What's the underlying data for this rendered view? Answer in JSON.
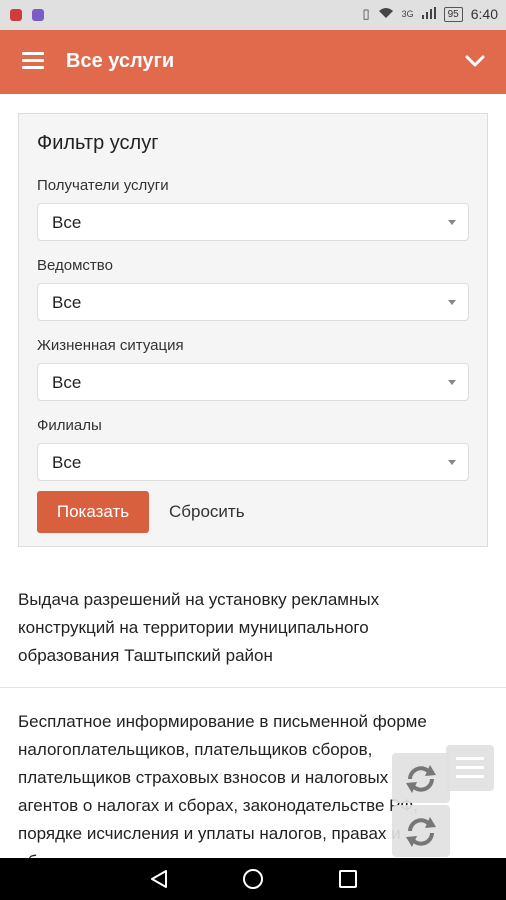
{
  "status_bar": {
    "time": "6:40",
    "network_label": "3G",
    "battery_level": "95"
  },
  "app_bar": {
    "title": "Все услуги"
  },
  "filter": {
    "title": "Фильтр услуг",
    "fields": [
      {
        "label": "Получатели услуги",
        "value": "Все"
      },
      {
        "label": "Ведомство",
        "value": "Все"
      },
      {
        "label": "Жизненная ситуация",
        "value": "Все"
      },
      {
        "label": "Филиалы",
        "value": "Все"
      }
    ],
    "show_label": "Показать",
    "reset_label": "Сбросить"
  },
  "services": [
    {
      "lines": [
        "Выдача разрешений на установку рекламных",
        "конструкций на территории муниципального",
        "образования Таштыпский район"
      ]
    },
    {
      "lines": [
        "Бесплатное информирование в письменной форме",
        "налогоплательщиков, плательщиков сборов,",
        "плательщиков страховых взносов и налоговых",
        "агентов о налогах и сборах, законодательстве РФ,",
        "порядке исчисления и уплаты налогов, правах и",
        "обязанностях"
      ]
    }
  ],
  "colors": {
    "accent": "#e06a4b",
    "button": "#d9603f"
  },
  "icons": [
    "menu-icon",
    "chevron-down-icon",
    "wifi-icon",
    "signal-icon",
    "battery-icon",
    "sync-icon",
    "refresh-icon",
    "back-icon",
    "home-icon",
    "recent-apps-icon"
  ]
}
